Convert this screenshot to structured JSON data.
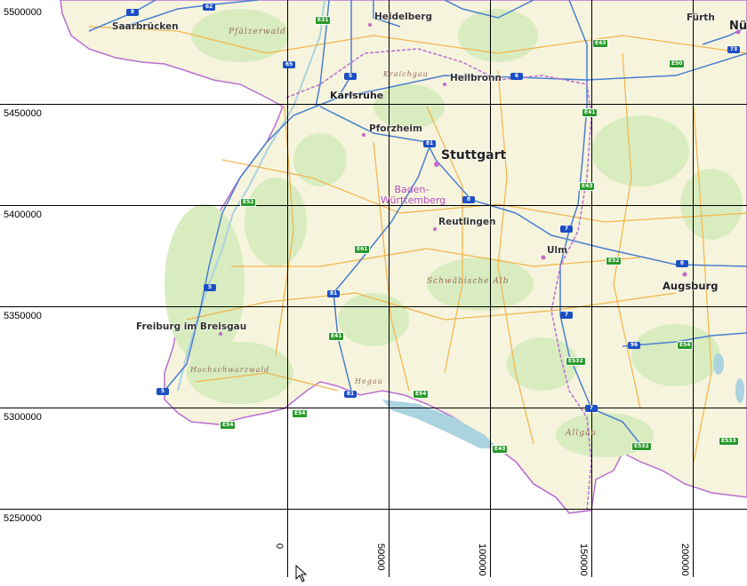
{
  "map": {
    "colors": {
      "land": "#f6f4dc",
      "forest": "#d8ecc0",
      "water": "#aad3df",
      "road": "#f2b34a",
      "border": "#b96fd0",
      "highway": "#4b7fd1",
      "grid": "#000000"
    }
  },
  "grid": {
    "y_labels": [
      "5500000",
      "5450000",
      "5400000",
      "5350000",
      "5300000",
      "5250000"
    ],
    "x_labels": [
      "0",
      "50000",
      "100000",
      "150000",
      "200000"
    ]
  },
  "places": {
    "saarbruecken": "Saarbrücken",
    "heidelberg": "Heidelberg",
    "fuerth": "Fürth",
    "nuernberg": "Nür",
    "karlsruhe": "Karlsruhe",
    "heilbronn": "Heilbronn",
    "pforzheim": "Pforzheim",
    "stuttgart": "Stuttgart",
    "reutlingen": "Reutlingen",
    "ulm": "Ulm",
    "augsburg": "Augsburg",
    "freiburg": "Freiburg im Breisgau"
  },
  "regions": {
    "pfaelzerwald": "Pfälzerwald",
    "kraichgau": "Kraichgau",
    "schwaebische_alb": "Schwäbische Alb",
    "hochschwarzwald": "Hochschwarzwald",
    "hegau": "Hegau",
    "allgaeu": "Allgäu"
  },
  "state": {
    "line1": "Baden-",
    "line2": "Württemberg"
  },
  "shields": {
    "a8_nw": "8",
    "a62": "62",
    "e31": "E31",
    "a65": "65",
    "a5_n": "5",
    "a6": "6",
    "e43_n": "E43",
    "e50": "E50",
    "a73": "73",
    "e41_n": "E41",
    "a81_n": "81",
    "a8_c": "8",
    "e43_c": "E43",
    "e52_w": "E52",
    "a7_n": "7",
    "e61": "E61",
    "e52_e": "E52",
    "a8_e": "8",
    "a5_w": "5",
    "a81_s": "81",
    "a7_s": "7",
    "e41_s": "E41",
    "e532": "E532",
    "a96": "96",
    "e54_e": "E54",
    "a5_sw": "5",
    "a81_x": "81",
    "e54_c": "E54",
    "e54_w": "E54",
    "e54_s": "E54",
    "e43_s": "E43",
    "e532_s": "E532",
    "e533": "E533",
    "a7_x": "7"
  }
}
